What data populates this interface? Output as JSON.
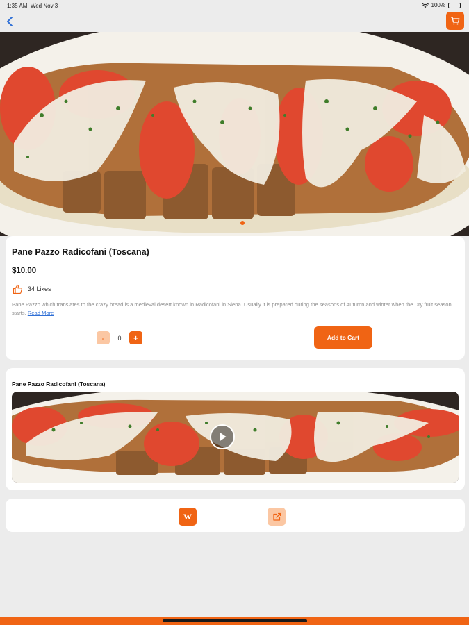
{
  "status_bar": {
    "time": "1:35 AM",
    "date": "Wed Nov 3",
    "battery": "100%"
  },
  "nav": {
    "back_icon": "chevron-left-icon",
    "cart_icon": "cart-icon"
  },
  "product": {
    "title": "Pane Pazzo Radicofani (Toscana)",
    "price": "$10.00",
    "likes": "34 Likes",
    "description": "Pane Pazzo which translates to the crazy bread is a medieval desert known in Radicofani in Siena. Usually it is prepared during the seasons of Autumn and winter when the Dry fruit season starts.",
    "read_more": "Read More",
    "quantity": "0",
    "minus": "-",
    "plus": "+",
    "add_to_cart": "Add to Cart"
  },
  "video": {
    "title": "Pane Pazzo Radicofani (Toscana)",
    "play_icon": "play-icon"
  },
  "links": {
    "wiki_label": "W",
    "share_icon": "external-link-icon"
  },
  "colors": {
    "accent": "#f06414",
    "accent_light": "#fbc7a3",
    "background": "#ececec",
    "link": "#2f6fd6"
  }
}
